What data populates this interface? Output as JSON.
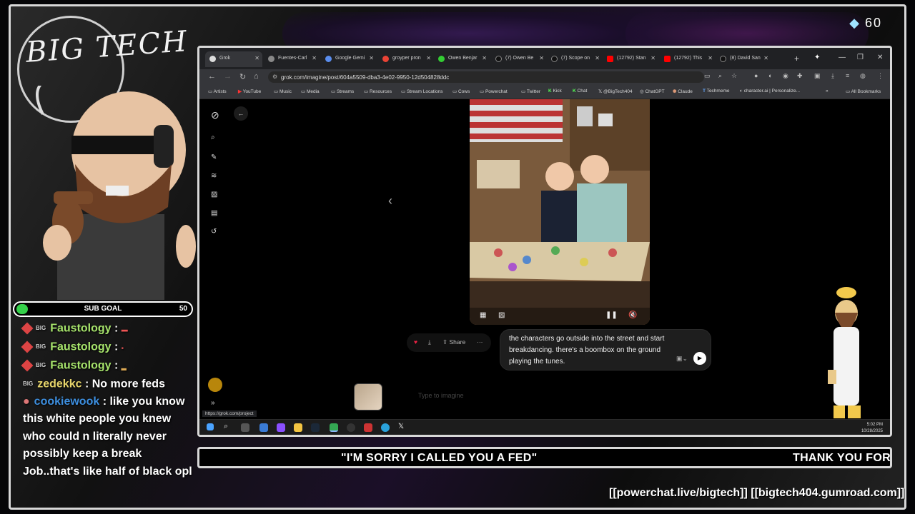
{
  "overlay": {
    "logo_text": "BIG TECH",
    "gem_count": "60",
    "subgoal": {
      "label": "SUB GOAL",
      "value": "50"
    },
    "chat": [
      {
        "user": "Faustology",
        "text": "",
        "color": "#a6e36b"
      },
      {
        "user": "Faustology",
        "text": "",
        "color": "#a6e36b"
      },
      {
        "user": "Faustology",
        "text": "",
        "color": "#a6e36b"
      },
      {
        "user": "zedekkc",
        "text": "No more feds",
        "color": "#e6d46b"
      },
      {
        "user": "cookiewook",
        "text": "like you know this white people you knew who could n literally never possibly keep a break Job..that's like half of black opl",
        "color": "#3d8fe0"
      }
    ],
    "ticker": [
      "\"I'M SORRY I CALLED YOU A FED\"",
      "THANK YOU FOR"
    ],
    "links": "[[powerchat.live/bigtech]] [[bigtech404.gumroad.com]]"
  },
  "browser": {
    "tabs": [
      "Grok",
      "Fuentes-Carl",
      "Google Gemi",
      "groyper pron",
      "Owen Benjar",
      "(7) Owen Be",
      "(7) Scope on",
      "(12792) Stan",
      "(12792) This",
      "(8) David San"
    ],
    "url": "grok.com/imagine/post/604a5509-dba3-4e02-9950-12d504828ddc",
    "bookmarks": [
      "Artists",
      "YouTube",
      "Music",
      "Media",
      "Streams",
      "Resources",
      "Stream Locations",
      "Cows",
      "Powerchat",
      "Twitter",
      "Kick",
      "Chat",
      "@BigTech404",
      "ChatGPT",
      "Claude",
      "Techmeme",
      "character.ai | Personalize...",
      "All Bookmarks"
    ],
    "share_label": "Share",
    "prompt_text": "the characters go outside into the street and start breakdancing. there's a boombox on the ground playing the tunes.",
    "input_placeholder": "Type to imagine",
    "status_url": "https://grok.com/project",
    "clock_time": "5:02 PM",
    "clock_date": "10/28/2025"
  },
  "colors": {
    "subgoal_fill": "#35d04a",
    "chat_user_faustology": "#a6e36b",
    "chat_user_cookiewook": "#3d8fe0"
  }
}
